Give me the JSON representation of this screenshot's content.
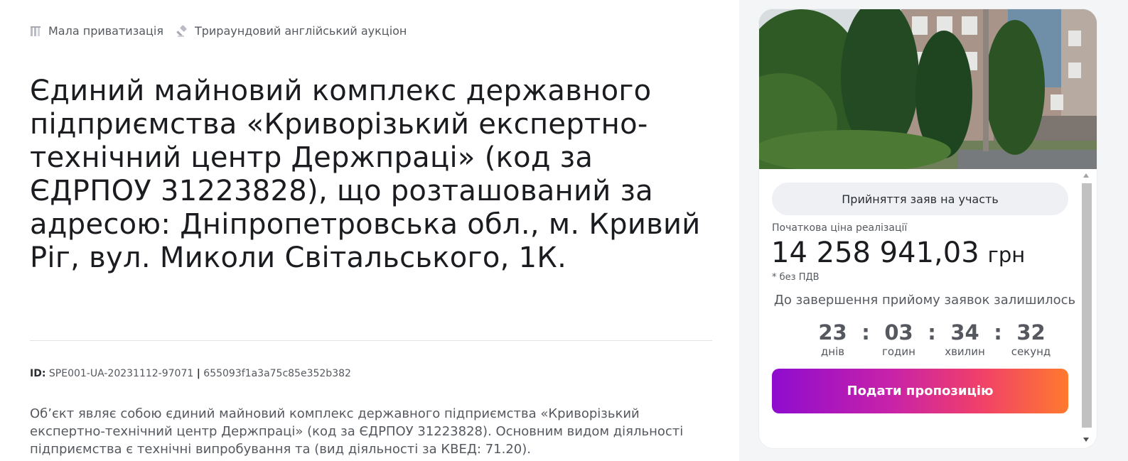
{
  "breadcrumbs": {
    "category": "Мала приватизація",
    "auction_type": "Трираундовий англійський аукціон"
  },
  "lot": {
    "title": "Єдиний майновий комплекс державного підприємства «Криворізький експертно-технічний центр Держпраці» (код за ЄДРПОУ 31223828), що розташований за адресою: Дніпропетровська обл., м. Кривий Ріг, вул. Миколи Світальського, 1К.",
    "id_label": "ID:",
    "id_value": "SPE001-UA-20231112-97071",
    "id_separator": "|",
    "hash": "655093f1a3a75c85e352b382",
    "description": "Об’єкт являє собою єдиний майновий комплекс державного підприємства «Криворізький експертно-технічний центр Держпраці» (код за ЄДРПОУ 31223828). Основним видом діяльності підприємства є технічні випробування та (вид діяльності за КВЕД: 71.20)."
  },
  "card": {
    "status": "Прийняття заяв на участь",
    "price_label": "Початкова ціна реалізації",
    "price": "14 258 941,03",
    "currency": "грн",
    "vat_note": "* без ПДВ",
    "remaining_label": "До завершення прийому заявок залишилось",
    "timer": {
      "days": "23",
      "days_label": "днів",
      "hours": "03",
      "hours_label": "годин",
      "minutes": "34",
      "minutes_label": "хвилин",
      "seconds": "32",
      "seconds_label": "секунд",
      "separator": ":"
    },
    "submit_button": "Подати пропозицію"
  },
  "colors": {
    "button_gradient_start": "#8e0ccf",
    "button_gradient_end": "#ff7a2e",
    "status_pill_bg": "#eef0f3",
    "muted_text": "#55595f"
  },
  "icons": {
    "category": "building-columns-icon",
    "auction_type": "gavel-icon"
  }
}
